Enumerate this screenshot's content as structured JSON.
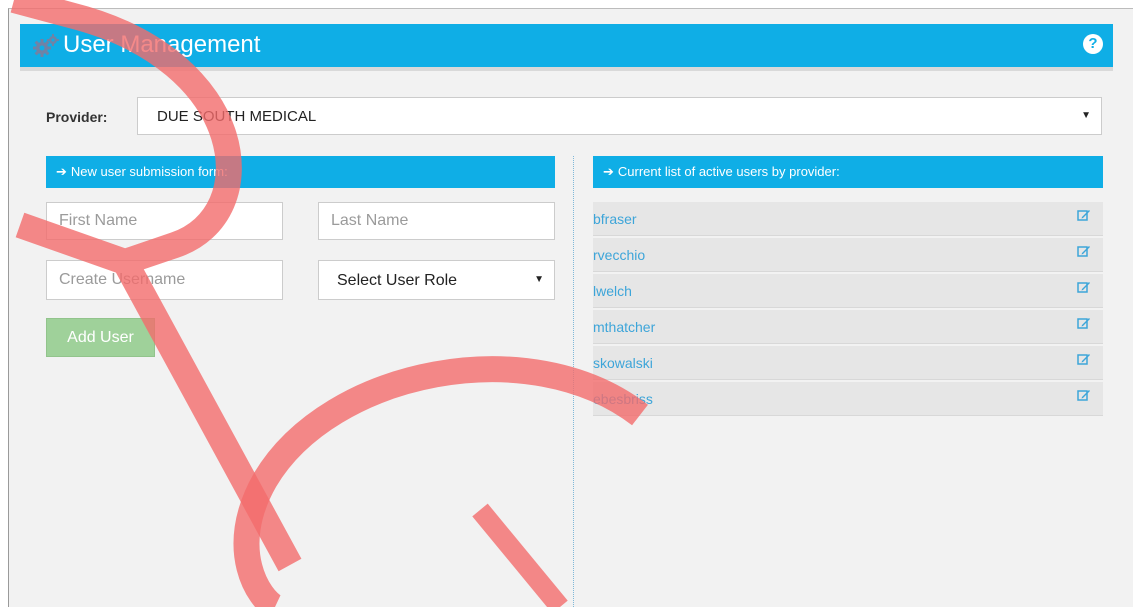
{
  "header": {
    "title": "User Management",
    "settings_icon": "gears-icon",
    "help_icon": "question-circle-icon",
    "help_glyph": "?"
  },
  "provider": {
    "label": "Provider:",
    "selected": "DUE SOUTH MEDICAL"
  },
  "form": {
    "heading": "New user submission form:",
    "first_name_placeholder": "First Name",
    "last_name_placeholder": "Last Name",
    "username_placeholder": "Create Username",
    "role_selected": "Select User Role",
    "add_button": "Add User"
  },
  "users_panel": {
    "heading": "Current list of active users by provider:",
    "users": [
      "bfraser",
      "rvecchio",
      "lwelch",
      "mthatcher",
      "skowalski",
      "ebesbriss"
    ],
    "edit_icon": "edit-icon"
  },
  "watermark": {
    "text": "RC",
    "color": "#f26b6b"
  },
  "colors": {
    "accent": "#0faee6",
    "success_button": "#9fd19a",
    "link": "#3da5d9"
  }
}
